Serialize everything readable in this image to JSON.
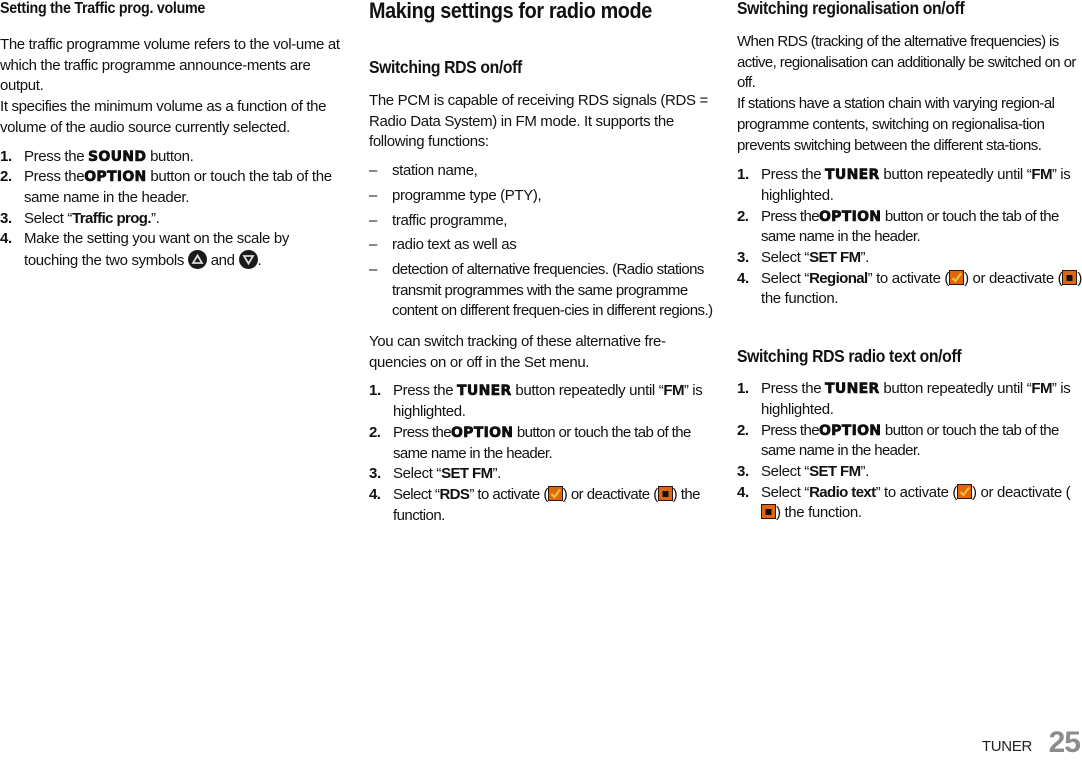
{
  "column1": {
    "heading": "Setting the Traffic prog. volume",
    "para1": "The traffic programme volume refers to the vol-ume at which the traffic programme announce-ments are output.",
    "para2": "It specifies the minimum volume as a function of the volume of the audio source currently selected.",
    "steps": [
      {
        "num": "1.",
        "pre": "Press the",
        "button": "SOUND",
        "post": " button."
      },
      {
        "num": "2.",
        "pre": "Press the",
        "button": "OPTION",
        "post": " button or touch the tab of the same name in the header."
      },
      {
        "num": "3.",
        "pre": "Select “",
        "selection": "Traffic prog.",
        "post": "”."
      },
      {
        "num": "4.",
        "pre": "Make the setting you want on the scale by touching the two symbols",
        "mid": "and",
        "post": ".",
        "icons": [
          "arrow-up-icon",
          "arrow-down-icon"
        ]
      }
    ]
  },
  "column2": {
    "title": "Making settings for radio mode",
    "section_heading": "Switching RDS on/off",
    "intro": "The PCM is capable of receiving RDS signals (RDS = Radio Data System) in FM mode. It supports the following functions:",
    "functions": [
      "station name,",
      "programme type (PTY),",
      "traffic programme,",
      "radio text as well as",
      "detection of alternative frequencies. (Radio stations transmit programmes with the same programme content on different frequen-cies in different regions.)"
    ],
    "dash": "–",
    "outro": "You can switch tracking of these alternative fre-quencies on or off in the Set menu.",
    "steps": [
      {
        "num": "1.",
        "pre": "Press the",
        "button": "TUNER",
        "post": " button repeatedly until “",
        "selection": "FM",
        "post2": "” is highlighted."
      },
      {
        "num": "2.",
        "pre": "Press the",
        "button": "OPTION",
        "post": " button or touch the tab of the same name in the header."
      },
      {
        "num": "3.",
        "pre": "Select “",
        "selection": "SET FM",
        "post": "”."
      },
      {
        "num": "4.",
        "pre": "Select “",
        "selection": "RDS",
        "post": "” to activate (",
        "mid": ") or deactivate (",
        "post2": ") the function."
      }
    ]
  },
  "column3": {
    "section1": {
      "heading": "Switching regionalisation on/off",
      "para1": "When RDS (tracking of the alternative frequencies) is active, regionalisation can additionally be switched on or off.",
      "para2": "If stations have a station chain with varying region-al programme contents, switching on regionalisa-tion prevents switching between the different sta-tions.",
      "steps": [
        {
          "num": "1.",
          "pre": "Press the",
          "button": "TUNER",
          "post": " button repeatedly until “",
          "selection": "FM",
          "post2": "” is highlighted."
        },
        {
          "num": "2.",
          "pre": "Press the",
          "button": "OPTION",
          "post": " button or touch the tab of the same name in the header."
        },
        {
          "num": "3.",
          "pre": "Select “",
          "selection": "SET FM",
          "post": "”."
        },
        {
          "num": "4.",
          "pre": "Select “",
          "selection": "Regional",
          "post": "” to activate (",
          "mid": ") or deactivate (",
          "post2": ") the function."
        }
      ]
    },
    "section2": {
      "heading": "Switching RDS radio text on/off",
      "steps": [
        {
          "num": "1.",
          "pre": "Press the",
          "button": "TUNER",
          "post": " button repeatedly until “",
          "selection": "FM",
          "post2": "” is highlighted."
        },
        {
          "num": "2.",
          "pre": "Press the",
          "button": "OPTION",
          "post": " button or touch the tab of the same name in the header."
        },
        {
          "num": "3.",
          "pre": "Select “",
          "selection": "SET FM",
          "post": "”."
        },
        {
          "num": "4.",
          "pre": "Select “",
          "selection": "Radio text",
          "post": "” to activate (",
          "mid": ") or deactivate (",
          "post2": ") the function."
        }
      ]
    }
  },
  "footer": {
    "chapter": "TUNER",
    "page_number": "25"
  },
  "colors": {
    "text": "#111111",
    "page_number": "#8c8c8c",
    "checkbox_orange": "#e0660f",
    "checkbox_check": "#f2c230"
  }
}
